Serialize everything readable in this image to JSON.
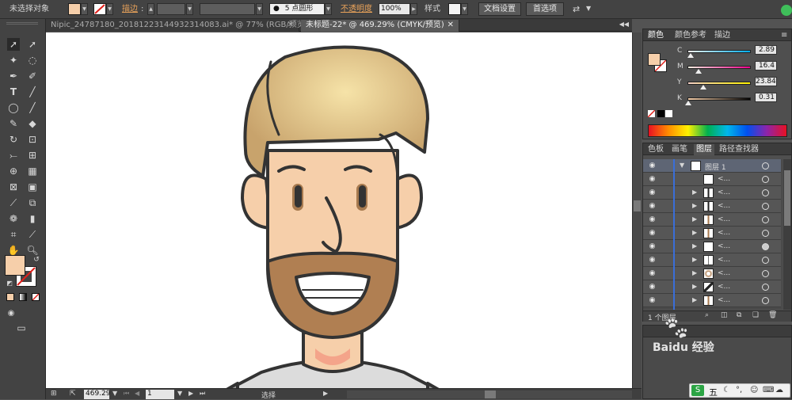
{
  "control_bar": {
    "selection": "未选择对象",
    "stroke_label": "描边",
    "brush": "5 点圆形",
    "opacity_label": "不透明度",
    "opacity_value": "100%",
    "style_label": "样式",
    "doc_settings": "文档设置",
    "preferences": "首选项",
    "fill_color": "#f6cfaa"
  },
  "tabs": [
    {
      "label": "Nipic_24787180_20181223144932314083.ai* @ 77% (RGB/预览)"
    },
    {
      "label": "未标题-22* @ 469.29% (CMYK/预览)"
    }
  ],
  "color_panel": {
    "tabs": [
      "颜色",
      "颜色参考",
      "描边"
    ],
    "C": "2.89",
    "M": "16.4",
    "Y": "23.84",
    "K": "0.31",
    "c_label": "C",
    "m_label": "M",
    "y_label": "Y",
    "k_label": "K"
  },
  "layers_panel": {
    "tabs": [
      "色板",
      "画笔",
      "图层",
      "路径查找器"
    ],
    "layer_name": "图层 1",
    "sublayer_label": "<...",
    "footer_count": "1 个图层"
  },
  "status_bar": {
    "zoom": "469.29",
    "page": "1",
    "tool": "选择"
  },
  "watermark": {
    "text": "Baidu 经验"
  },
  "ime": {
    "text": "五"
  }
}
